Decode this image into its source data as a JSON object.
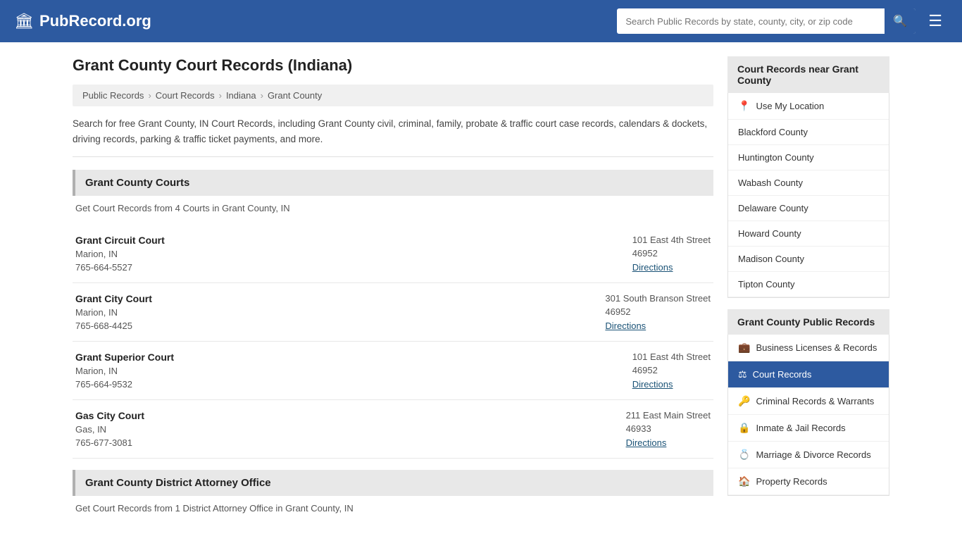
{
  "header": {
    "logo_icon": "🏛",
    "logo_text": "PubRecord.org",
    "search_placeholder": "Search Public Records by state, county, city, or zip code",
    "search_icon": "🔍",
    "menu_icon": "☰"
  },
  "page": {
    "title": "Grant County Court Records (Indiana)",
    "description": "Search for free Grant County, IN Court Records, including Grant County civil, criminal, family, probate & traffic court case records, calendars & dockets, driving records, parking & traffic ticket payments, and more."
  },
  "breadcrumb": {
    "items": [
      "Public Records",
      "Court Records",
      "Indiana",
      "Grant County"
    ]
  },
  "courts_section": {
    "header": "Grant County Courts",
    "desc": "Get Court Records from 4 Courts in Grant County, IN",
    "courts": [
      {
        "name": "Grant Circuit Court",
        "city": "Marion, IN",
        "phone": "765-664-5527",
        "address": "101 East 4th Street",
        "zip": "46952",
        "directions": "Directions"
      },
      {
        "name": "Grant City Court",
        "city": "Marion, IN",
        "phone": "765-668-4425",
        "address": "301 South Branson Street",
        "zip": "46952",
        "directions": "Directions"
      },
      {
        "name": "Grant Superior Court",
        "city": "Marion, IN",
        "phone": "765-664-9532",
        "address": "101 East 4th Street",
        "zip": "46952",
        "directions": "Directions"
      },
      {
        "name": "Gas City Court",
        "city": "Gas, IN",
        "phone": "765-677-3081",
        "address": "211 East Main Street",
        "zip": "46933",
        "directions": "Directions"
      }
    ]
  },
  "da_section": {
    "header": "Grant County District Attorney Office",
    "desc": "Get Court Records from 1 District Attorney Office in Grant County, IN"
  },
  "sidebar": {
    "nearby_title": "Court Records near Grant County",
    "location_label": "Use My Location",
    "nearby_counties": [
      "Blackford County",
      "Huntington County",
      "Wabash County",
      "Delaware County",
      "Howard County",
      "Madison County",
      "Tipton County"
    ],
    "public_records_title": "Grant County Public Records",
    "public_records_items": [
      {
        "icon": "💼",
        "label": "Business Licenses & Records",
        "active": false
      },
      {
        "icon": "⚖",
        "label": "Court Records",
        "active": true
      },
      {
        "icon": "🔑",
        "label": "Criminal Records & Warrants",
        "active": false
      },
      {
        "icon": "🔒",
        "label": "Inmate & Jail Records",
        "active": false
      },
      {
        "icon": "💍",
        "label": "Marriage & Divorce Records",
        "active": false
      },
      {
        "icon": "🏠",
        "label": "Property Records",
        "active": false
      }
    ]
  }
}
